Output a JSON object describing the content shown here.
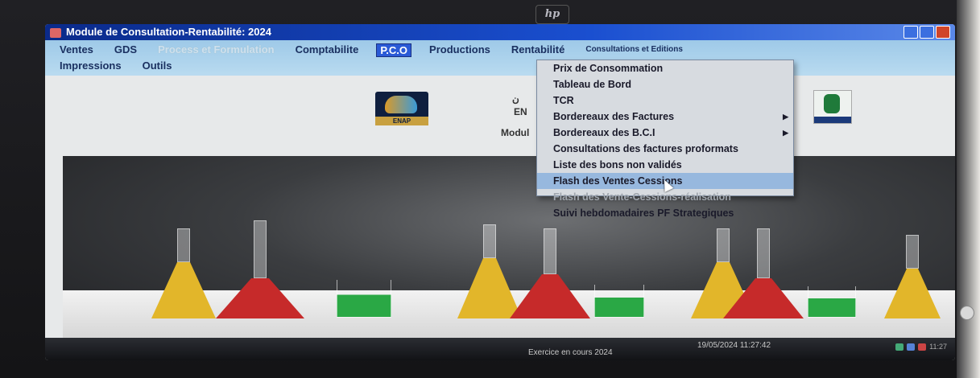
{
  "device": {
    "brand": "hp"
  },
  "window": {
    "title": "Module de Consultation-Rentabilité: 2024"
  },
  "menubar": {
    "row1": [
      "Ventes",
      "GDS",
      "Process et Formulation",
      "Comptabilite",
      "P.C.O",
      "Productions",
      "Rentabilité",
      "Consultations et Editions"
    ],
    "row2": [
      "Impressions",
      "Outils"
    ],
    "active": "P.C.O",
    "disabled": [
      "Process et Formulation"
    ]
  },
  "header": {
    "left_logo_label": "ENAP",
    "text_fragment_1": "ن",
    "text_fragment_2": "EN",
    "text_fragment_3": "Modul"
  },
  "dropdown": {
    "items": [
      {
        "label": "Prix de Consommation",
        "submenu": false,
        "state": "normal"
      },
      {
        "label": "Tableau de Bord",
        "submenu": false,
        "state": "normal"
      },
      {
        "label": "TCR",
        "submenu": false,
        "state": "normal"
      },
      {
        "label": "Bordereaux des Factures",
        "submenu": true,
        "state": "normal"
      },
      {
        "label": "Bordereaux des B.C.I",
        "submenu": true,
        "state": "normal"
      },
      {
        "label": "Consultations des factures proformats",
        "submenu": false,
        "state": "normal"
      },
      {
        "label": "Liste des bons non validés",
        "submenu": false,
        "state": "normal"
      },
      {
        "label": "Flash des Ventes Cessions",
        "submenu": false,
        "state": "highlighted"
      },
      {
        "label": "Flash des Vente-Cessions-réalisation",
        "submenu": false,
        "state": "disabled"
      },
      {
        "label": "Suivi hebdomadaires PF Strategiques",
        "submenu": false,
        "state": "normal"
      }
    ]
  },
  "statusbar": {
    "exercise": "Exercice en cours 2024",
    "datetime": "19/05/2024 11:27:42",
    "clock": "11:27"
  },
  "colors": {
    "titlebar": "#1a4fd0",
    "menubar": "#b9dbf0",
    "highlight": "#97b8de",
    "active_menu": "#2a5ad6"
  }
}
